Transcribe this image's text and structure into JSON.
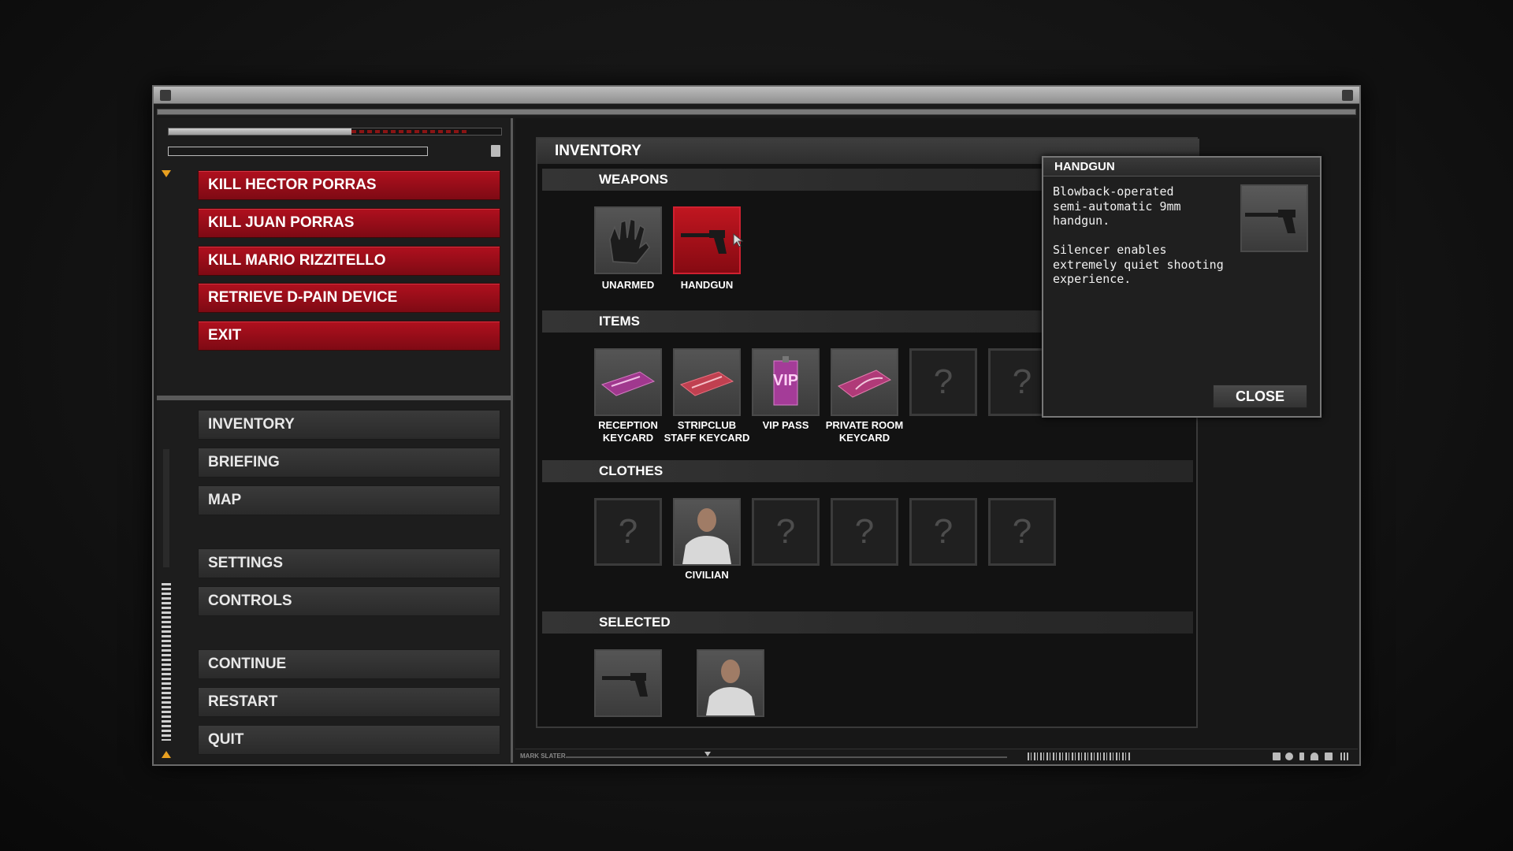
{
  "left_panel": {
    "objectives": [
      {
        "label": "KILL HECTOR PORRAS"
      },
      {
        "label": "KILL JUAN PORRAS"
      },
      {
        "label": "KILL MARIO RIZZITELLO"
      },
      {
        "label": "RETRIEVE D-PAIN DEVICE"
      },
      {
        "label": "EXIT"
      }
    ],
    "menu_group_1": [
      {
        "label": "INVENTORY"
      },
      {
        "label": "BRIEFING"
      },
      {
        "label": "MAP"
      }
    ],
    "menu_group_2": [
      {
        "label": "SETTINGS"
      },
      {
        "label": "CONTROLS"
      }
    ],
    "menu_group_3": [
      {
        "label": "CONTINUE"
      },
      {
        "label": "RESTART"
      },
      {
        "label": "QUIT"
      }
    ],
    "progress_fraction": 0.55
  },
  "inventory": {
    "title": "INVENTORY",
    "sections": {
      "weapons": {
        "title": "WEAPONS",
        "items": [
          {
            "label": "UNARMED",
            "icon": "glove-icon"
          },
          {
            "label": "HANDGUN",
            "icon": "handgun-icon",
            "active": true
          }
        ]
      },
      "items": {
        "title": "ITEMS",
        "items": [
          {
            "label": "RECEPTION KEYCARD",
            "icon": "keycard-icon"
          },
          {
            "label": "STRIPCLUB STAFF KEYCARD",
            "icon": "keycard-icon"
          },
          {
            "label": "VIP PASS",
            "icon": "vip-pass-icon",
            "badge": "VIP"
          },
          {
            "label": "PRIVATE ROOM KEYCARD",
            "icon": "keycard-icon"
          }
        ],
        "empty_slot_glyph": "?"
      },
      "clothes": {
        "title": "CLOTHES",
        "items": [
          {
            "label": "CIVILIAN",
            "icon": "civilian-outfit-icon"
          }
        ],
        "empty_slot_glyph": "?"
      },
      "selected": {
        "title": "SELECTED"
      }
    }
  },
  "tooltip": {
    "title": "HANDGUN",
    "description": "Blowback-operated\nsemi-automatic 9mm\nhandgun.\n\nSilencer enables\nextremely quiet shooting\nexperience.",
    "close_label": "CLOSE"
  },
  "status_bar": {
    "label": "MARK SLATER"
  },
  "colors": {
    "objective_red": "#9e0e1a",
    "active_slot_red": "#b01420",
    "accent_orange": "#e8a020",
    "panel_dark": "#1b1b1b"
  }
}
